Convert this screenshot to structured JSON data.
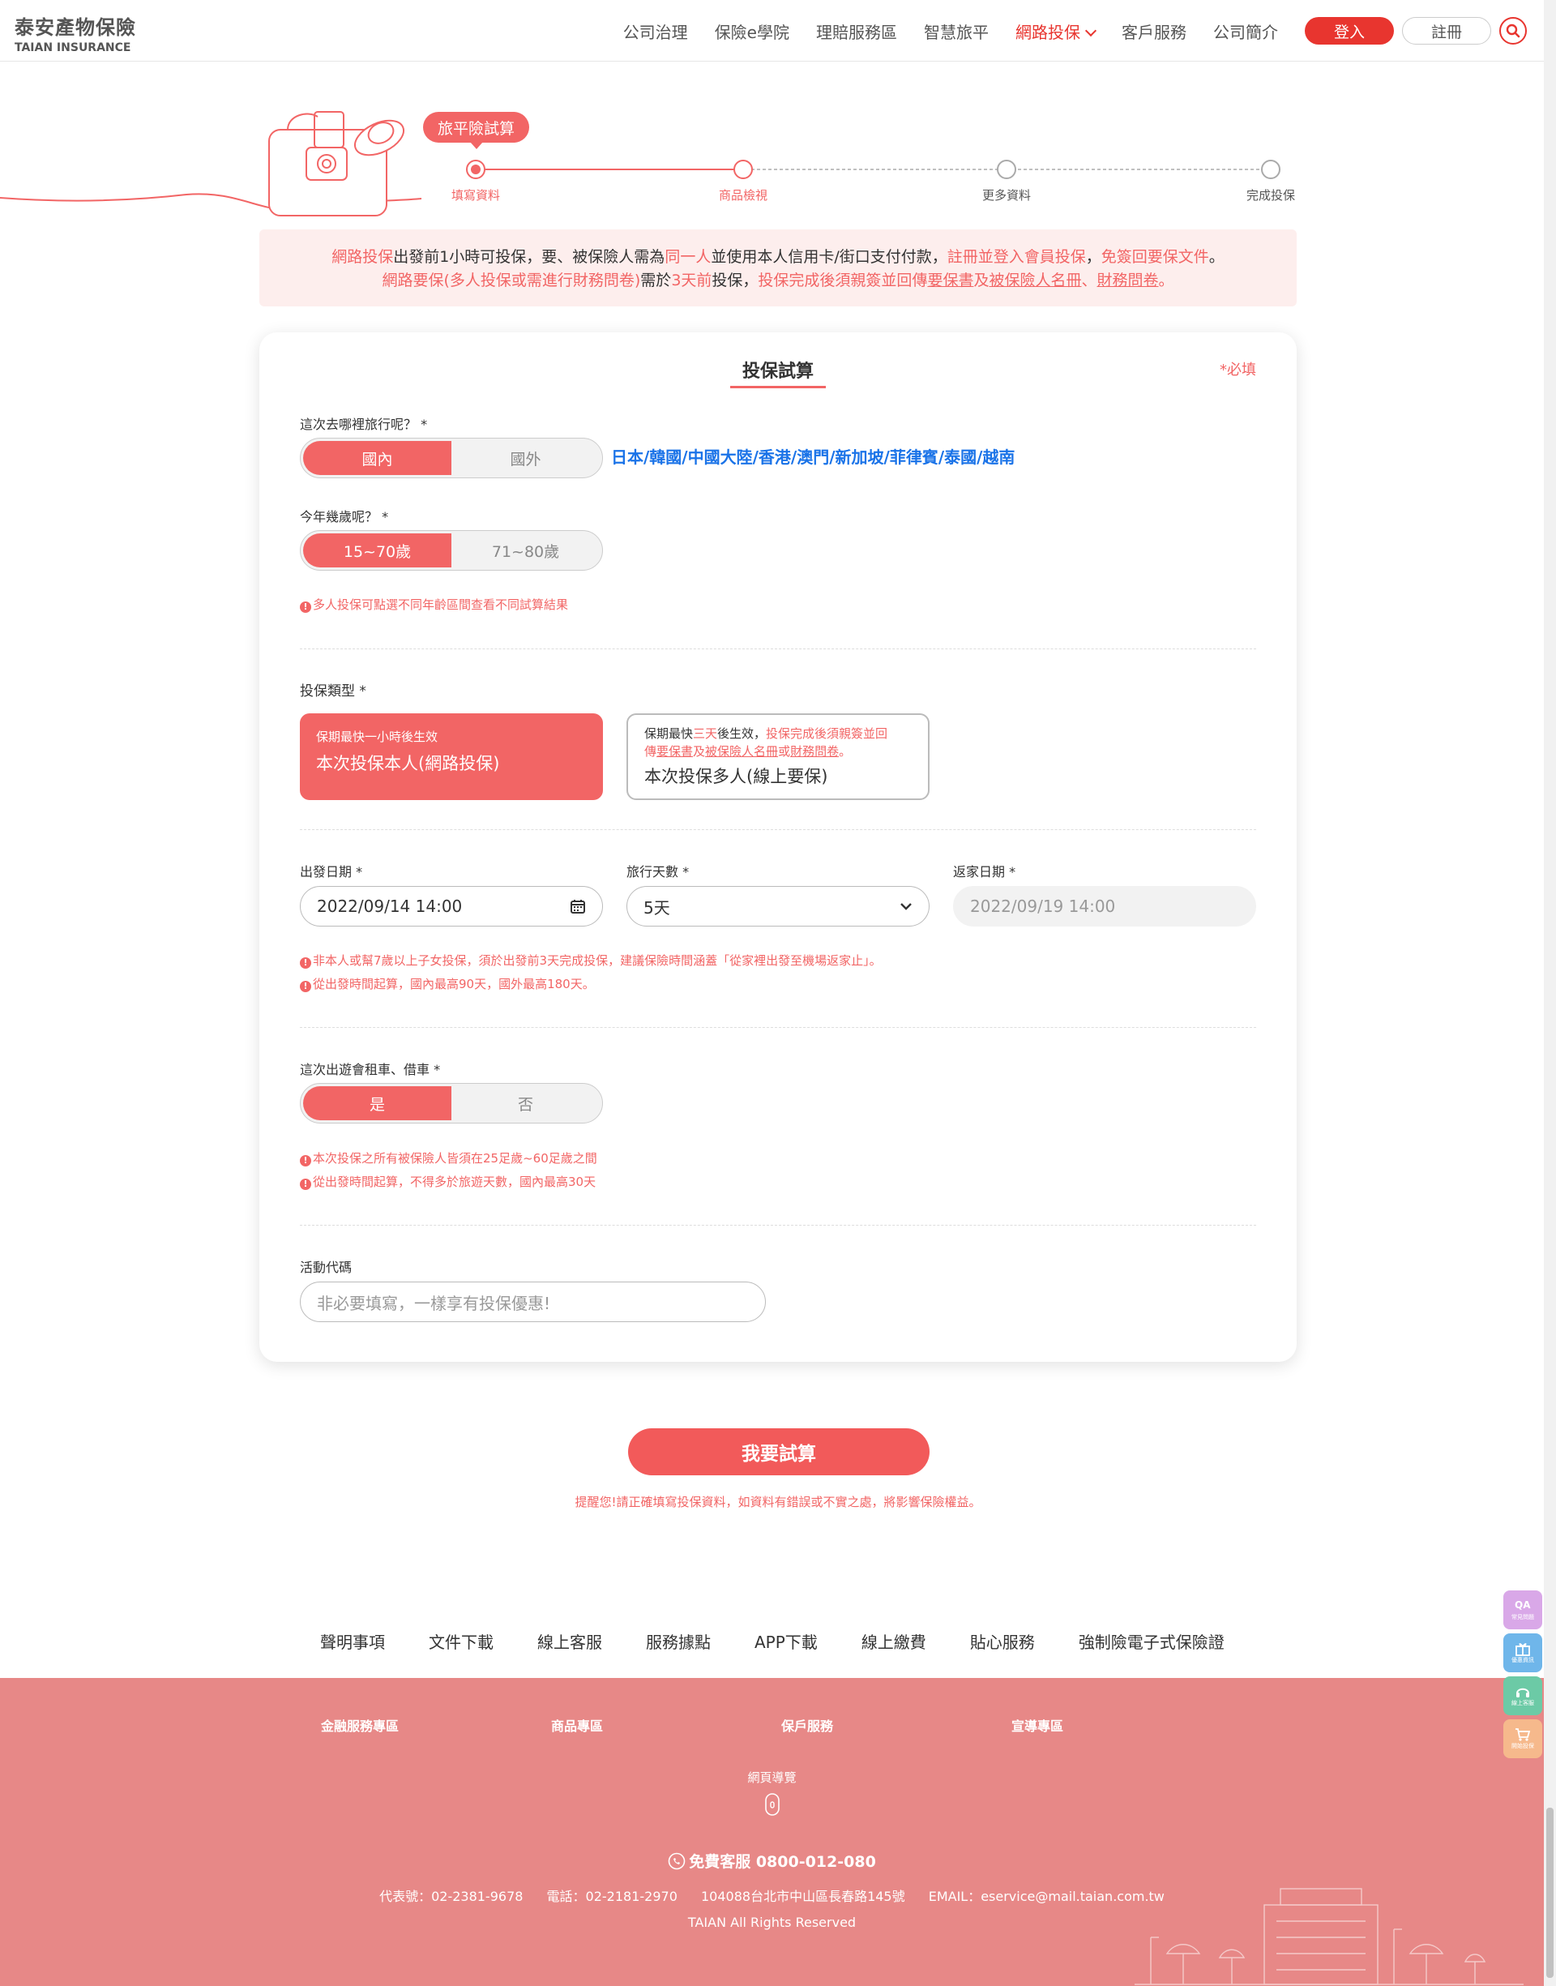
{
  "header": {
    "logo_zh": "泰安產物保險",
    "logo_en": "TAIAN INSURANCE",
    "nav": [
      "公司治理",
      "保險e學院",
      "理賠服務區",
      "智慧旅平",
      "網路投保",
      "客戶服務",
      "公司簡介"
    ],
    "login_label": "登入",
    "register_label": "註冊"
  },
  "progress": {
    "bubble": "旅平險試算",
    "steps": [
      "填寫資料",
      "商品檢視",
      "更多資料",
      "完成投保"
    ]
  },
  "notice": {
    "line1": {
      "a": "網路投保",
      "b": "出發前1小時可投保，要、被保險人需為",
      "c": "同一人",
      "d": "並使用本人信用卡/街口支付付款，",
      "e": "註冊並登入會員投保",
      "f": "，",
      "g": "免簽回要保文件",
      "h": "。"
    },
    "line2": {
      "a": "網路要保(多人投保或需進行財務問卷)",
      "b": "需於",
      "c": "3天前",
      "d": "投保，",
      "e": "投保完成後須親簽並回傳",
      "f": "要保書",
      "g": "及",
      "h": "被保險人名冊",
      "i": "、",
      "j": "財務問卷",
      "k": "。"
    }
  },
  "form": {
    "title": "投保試算",
    "required_note": "*必填",
    "destination": {
      "label": "這次去哪裡旅行呢？ *",
      "options": [
        "國內",
        "國外"
      ],
      "list": "日本/韓國/中國大陸/香港/澳門/新加坡/菲律賓/泰國/越南"
    },
    "age": {
      "label": "今年幾歲呢？ *",
      "options": [
        "15~70歲",
        "71~80歲"
      ],
      "hint": "多人投保可點選不同年齡區間查看不同試算結果"
    },
    "insure_type": {
      "label": "投保類型 *",
      "self_sub": "保期最快一小時後生效",
      "self_main": "本次投保本人(網路投保)",
      "multi_sub1a": "保期最快",
      "multi_sub1b": "三天",
      "multi_sub1c": "後生效，",
      "multi_sub1d": "投保完成後須親簽並回",
      "multi_sub2a": "傳",
      "multi_sub2b": "要保書",
      "multi_sub2c": "及",
      "multi_sub2d": "被保險人名冊",
      "multi_sub2e": "或",
      "multi_sub2f": "財務問卷",
      "multi_sub2g": "。",
      "multi_main": "本次投保多人(線上要保)"
    },
    "depart": {
      "label": "出發日期 *",
      "value": "2022/09/14 14:00"
    },
    "days": {
      "label": "旅行天數 *",
      "value": "5天"
    },
    "return": {
      "label": "返家日期 *",
      "value": "2022/09/19 14:00"
    },
    "date_hints": [
      "非本人或幫7歲以上子女投保，須於出發前3天完成投保，建議保險時間涵蓋「從家裡出發至機場返家止」。",
      "從出發時間起算，國內最高90天，國外最高180天。"
    ],
    "rental": {
      "label": "這次出遊會租車、借車 *",
      "options": [
        "是",
        "否"
      ],
      "hints": [
        "本次投保之所有被保險人皆須在25足歲~60足歲之間",
        "從出發時間起算，不得多於旅遊天數，國內最高30天"
      ]
    },
    "promo": {
      "label": "活動代碼",
      "placeholder": "非必要填寫，一樣享有投保優惠!"
    }
  },
  "submit": {
    "label": "我要試算",
    "note": "提醒您!請正確填寫投保資料，如資料有錯誤或不實之處，將影響保險權益。"
  },
  "footer_links": [
    "聲明事項",
    "文件下載",
    "線上客服",
    "服務據點",
    "APP下載",
    "線上繳費",
    "貼心服務",
    "強制險電子式保險證"
  ],
  "footer": {
    "categories": [
      "金融服務專區",
      "商品專區",
      "保戶服務",
      "宣導專區"
    ],
    "sitemap": "網頁導覽",
    "phone": "免費客服 0800-012-080",
    "contact": [
      "代表號：02-2381-9678",
      "電話：02-2181-2970",
      "104088台北市中山區長春路145號",
      "EMAIL：eservice@mail.taian.com.tw"
    ],
    "copyright": "TAIAN All Rights Reserved"
  },
  "floating": [
    "常見問題",
    "優惠資訊",
    "線上客服",
    "開始投保"
  ],
  "colors": {
    "brand_red": "#e8352f",
    "accent_pink": "#f26565",
    "footer_bg": "#e78887",
    "link_blue": "#1a73e8"
  }
}
